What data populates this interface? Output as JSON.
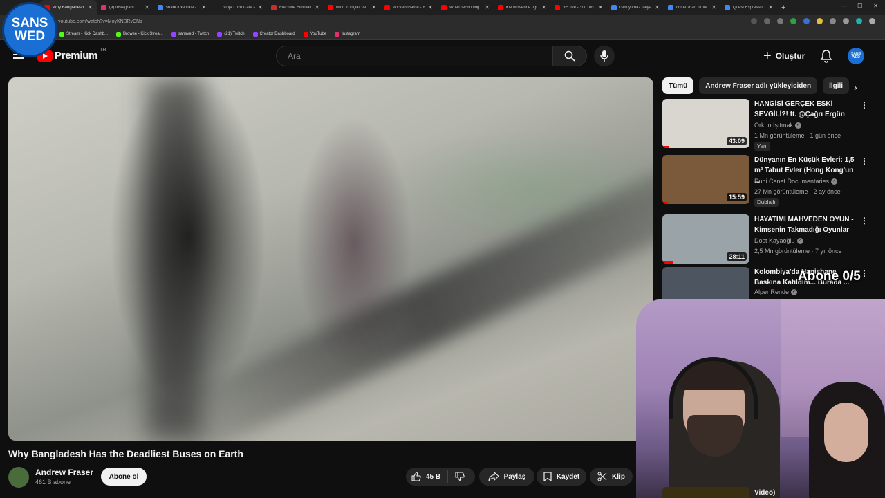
{
  "browser": {
    "tabs": [
      {
        "title": "Why Bangladesh",
        "active": true,
        "color": "#ff0000"
      },
      {
        "title": "(9) Instagram",
        "active": false,
        "color": "#e1306c"
      },
      {
        "title": "shark luxe cafe -",
        "active": false,
        "color": "#4285f4"
      },
      {
        "title": "Ninja Luxe Café P",
        "active": false,
        "color": "#1f1f1f"
      },
      {
        "title": "Electude Simulati",
        "active": false,
        "color": "#c4302b"
      },
      {
        "title": "wtcn'ın kıçlalı ile",
        "active": false,
        "color": "#ff0000"
      },
      {
        "title": "Wicked Game - Y",
        "active": false,
        "color": "#ff0000"
      },
      {
        "title": "When technolog",
        "active": false,
        "color": "#ff0000"
      },
      {
        "title": "the wolverine figl",
        "active": false,
        "color": "#ff0000"
      },
      {
        "title": "bf5 live - YouTub",
        "active": false,
        "color": "#ff0000"
      },
      {
        "title": "cem yılmaz italya",
        "active": false,
        "color": "#4285f4"
      },
      {
        "title": "chloé zhao filmle",
        "active": false,
        "color": "#4285f4"
      },
      {
        "title": "Quest Espresso",
        "active": false,
        "color": "#4285f4"
      }
    ],
    "new_tab": "+",
    "url": "youtube.com/watch?v=MoyKNBRvCNs",
    "bookmarks": [
      {
        "label": "Stream - Kick Dashb...",
        "color": "#53fc18"
      },
      {
        "label": "Browse - Kick Strea...",
        "color": "#53fc18"
      },
      {
        "label": "sansved - Twitch",
        "color": "#9146ff"
      },
      {
        "label": "(21) Twitch",
        "color": "#9146ff"
      },
      {
        "label": "Creator Dashboard",
        "color": "#9146ff"
      },
      {
        "label": "YouTube",
        "color": "#ff0000"
      },
      {
        "label": "Instagram",
        "color": "#e1306c"
      }
    ]
  },
  "logo_badge": {
    "line1": "SANS",
    "line2": "WED"
  },
  "header": {
    "logo_word": "Premium",
    "country": "TR",
    "search_placeholder": "Ara",
    "create_label": "Oluştur",
    "avatar_text": "SANS WED"
  },
  "video": {
    "title": "Why Bangladesh Has the Deadliest Buses on Earth",
    "channel": "Andrew Fraser",
    "subs": "461 B abone",
    "subscribe_label": "Abone ol",
    "likes": "45 B",
    "share_label": "Paylaş",
    "save_label": "Kaydet",
    "clip_label": "Klip",
    "more": "⋯"
  },
  "sidebar": {
    "chips": [
      "Tümü",
      "Andrew Fraser adlı yükleyiciden",
      "İlgili"
    ],
    "recommendations": [
      {
        "title": "HANGİSİ GERÇEK ESKİ SEVGİLİ?! ft. @Çağrı Ergün",
        "channel": "Orkun Işıtmak",
        "meta": "1 Mn görüntüleme · 1 gün önce",
        "badge": "Yeni",
        "duration": "43:09",
        "progress": 0.08,
        "thumb_color": "#d8d6cf"
      },
      {
        "title": "Dünyanın En Küçük Evleri: 1,5 m² Tabut Evler (Hong Kong'un ...",
        "channel": "Ruhi Cenet Documentaries",
        "meta": "27 Mn görüntüleme · 2 ay önce",
        "badge": "Dublajlı",
        "duration": "15:59",
        "progress": 0.06,
        "thumb_color": "#7a5a3a"
      },
      {
        "title": "HAYATIMI MAHVEDEN OYUN - Kimsenin Takmadığı Oyunlar",
        "channel": "Dost Kayaoğlu",
        "meta": "2,5 Mn görüntüleme · 7 yıl önce",
        "badge": "",
        "duration": "28:11",
        "progress": 0.12,
        "thumb_color": "#9aa3a8"
      },
      {
        "title": "Kolombiya'da Hapishane Baskına Katıldım... Burada ...",
        "channel": "Alper Rende",
        "meta": "",
        "badge": "",
        "duration": "",
        "progress": 0,
        "thumb_color": "#4d5560"
      }
    ],
    "overlay_text": "Abone 0/5",
    "last_title": "Video)"
  }
}
